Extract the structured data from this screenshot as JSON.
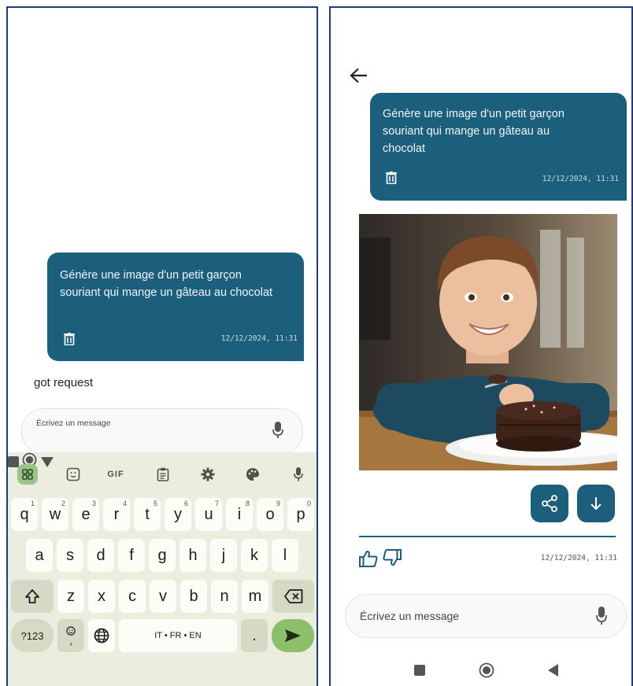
{
  "left_screen": {
    "user_message": {
      "text": "Génère une image d'un petit garçon souriant qui mange un gâteau au chocolat",
      "timestamp": "12/12/2024, 11:31"
    },
    "bot_reply": "got request",
    "input_placeholder": "Écrivez un message",
    "keyboard": {
      "toolbar_gif": "GIF",
      "row1": [
        {
          "key": "q",
          "hint": "1"
        },
        {
          "key": "w",
          "hint": "2"
        },
        {
          "key": "e",
          "hint": "3"
        },
        {
          "key": "r",
          "hint": "4"
        },
        {
          "key": "t",
          "hint": "5"
        },
        {
          "key": "y",
          "hint": "6"
        },
        {
          "key": "u",
          "hint": "7"
        },
        {
          "key": "i",
          "hint": "8"
        },
        {
          "key": "o",
          "hint": "9"
        },
        {
          "key": "p",
          "hint": "0"
        }
      ],
      "row2": [
        "a",
        "s",
        "d",
        "f",
        "g",
        "h",
        "j",
        "k",
        "l"
      ],
      "row3": [
        "z",
        "x",
        "c",
        "v",
        "b",
        "n",
        "m"
      ],
      "symbols_key": "?123",
      "emoji_key_hint": ",",
      "space_label": "IT • FR • EN",
      "period_key": "."
    }
  },
  "right_screen": {
    "user_message": {
      "text": "Génère une image d'un petit garçon souriant qui mange un gâteau au chocolat",
      "timestamp": "12/12/2024, 11:31"
    },
    "response_timestamp": "12/12/2024, 11:31",
    "input_placeholder": "Écrivez un message"
  },
  "colors": {
    "accent": "#1c5f7c",
    "keyboard_bg": "#ebeede",
    "send_key": "#8cbf69",
    "frame_border": "#1f3b7a"
  },
  "icons": {
    "left": [
      "trash-icon",
      "mic-icon",
      "apps-grid-icon",
      "sticker-icon",
      "clipboard-icon",
      "gear-icon",
      "palette-icon",
      "mic-icon",
      "shift-icon",
      "backspace-icon",
      "globe-icon",
      "send-icon",
      "nav-square-icon",
      "nav-circle-icon",
      "nav-triangle-icon"
    ],
    "right": [
      "back-arrow-icon",
      "trash-icon",
      "share-icon",
      "download-icon",
      "thumbs-up-icon",
      "thumbs-down-icon",
      "mic-icon",
      "nav-square-icon",
      "nav-circle-icon",
      "nav-back-icon"
    ]
  }
}
